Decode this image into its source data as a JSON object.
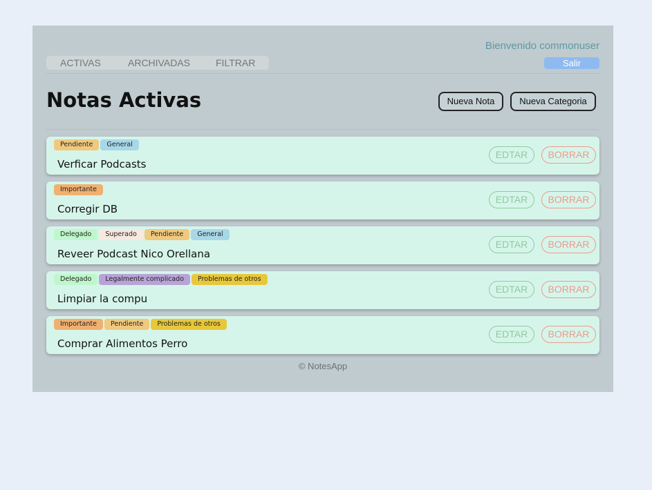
{
  "header": {
    "welcome": "Bienvenido commonuser",
    "logout_label": "Salir"
  },
  "nav": {
    "items": [
      {
        "label": "ACTIVAS"
      },
      {
        "label": "ARCHIVADAS"
      },
      {
        "label": "FILTRAR"
      }
    ]
  },
  "page": {
    "title": "Notas Activas",
    "new_note_label": "Nueva Nota",
    "new_category_label": "Nueva Categoria"
  },
  "tag_colors": {
    "Pendiente": "#f0c97e",
    "General": "#a8d8e8",
    "Importante": "#f0b070",
    "Delegado": "#bff7cc",
    "Superado": "#f7e8e0",
    "Legalmente complicado": "#b8a3d8",
    "Problemas de otros": "#e8c83a"
  },
  "notes": [
    {
      "title": "Verficar Podcasts",
      "tags": [
        "Pendiente",
        "General"
      ],
      "edit_label": "EDTAR",
      "delete_label": "BORRAR"
    },
    {
      "title": "Corregir DB",
      "tags": [
        "Importante"
      ],
      "edit_label": "EDTAR",
      "delete_label": "BORRAR"
    },
    {
      "title": "Reveer Podcast Nico Orellana",
      "tags": [
        "Delegado",
        "Superado",
        "Pendiente",
        "General"
      ],
      "edit_label": "EDTAR",
      "delete_label": "BORRAR"
    },
    {
      "title": "Limpiar la compu",
      "tags": [
        "Delegado",
        "Legalmente complicado",
        "Problemas de otros"
      ],
      "edit_label": "EDTAR",
      "delete_label": "BORRAR"
    },
    {
      "title": "Comprar Alimentos Perro",
      "tags": [
        "Importante",
        "Pendiente",
        "Problemas de otros"
      ],
      "edit_label": "EDTAR",
      "delete_label": "BORRAR"
    }
  ],
  "footer": {
    "text": "© NotesApp"
  }
}
